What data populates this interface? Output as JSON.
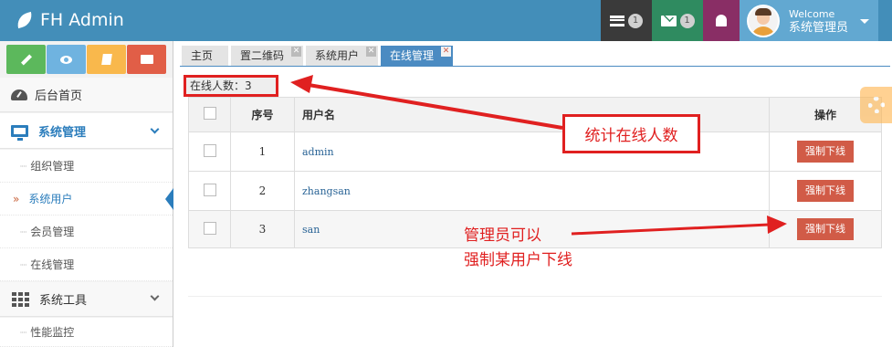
{
  "app": {
    "title": "FH Admin"
  },
  "topnav": {
    "tasks_count": "1",
    "messages_count": "1",
    "user_welcome": "Welcome",
    "user_name": "系统管理员"
  },
  "sidebar": {
    "shortcuts": [
      {
        "icon": "pencil-icon",
        "color": "#5cb85c"
      },
      {
        "icon": "eye-icon",
        "color": "#6fb3e0"
      },
      {
        "icon": "book-icon",
        "color": "#f9b84c"
      },
      {
        "icon": "folder-icon",
        "color": "#e15e47"
      }
    ],
    "items": [
      {
        "label": "后台首页"
      },
      {
        "label": "系统管理",
        "subitems": [
          "组织管理",
          "系统用户",
          "会员管理",
          "在线管理"
        ]
      },
      {
        "label": "系统工具",
        "subitems": [
          "性能监控"
        ]
      }
    ]
  },
  "tabs": [
    {
      "label": "主页",
      "closable": false
    },
    {
      "label": "置二维码",
      "closable": true
    },
    {
      "label": "系统用户",
      "closable": true
    },
    {
      "label": "在线管理",
      "closable": true,
      "active": true
    }
  ],
  "online": {
    "count_label": "在线人数：3"
  },
  "table": {
    "headers": [
      "序号",
      "用户名",
      "操作"
    ],
    "rows": [
      {
        "index": "1",
        "username": "admin",
        "action": "强制下线"
      },
      {
        "index": "2",
        "username": "zhangsan",
        "action": "强制下线"
      },
      {
        "index": "3",
        "username": "san",
        "action": "强制下线"
      }
    ]
  },
  "annotations": {
    "count_note": "统计在线人数",
    "kick_note_line1": "管理员可以",
    "kick_note_line2": "强制某用户下线",
    "color": "#e02020"
  }
}
